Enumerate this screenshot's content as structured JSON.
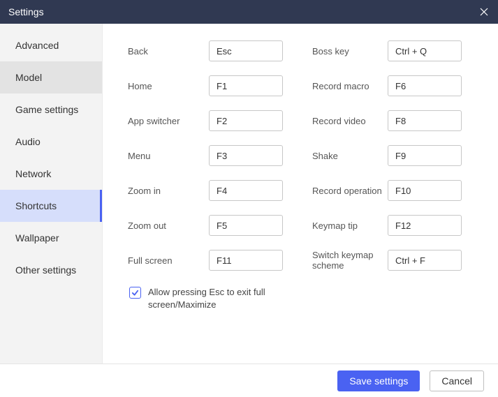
{
  "title": "Settings",
  "sidebar": {
    "items": [
      {
        "label": "Advanced",
        "active": false,
        "highlight": false
      },
      {
        "label": "Model",
        "active": false,
        "highlight": true
      },
      {
        "label": "Game settings",
        "active": false,
        "highlight": false
      },
      {
        "label": "Audio",
        "active": false,
        "highlight": false
      },
      {
        "label": "Network",
        "active": false,
        "highlight": false
      },
      {
        "label": "Shortcuts",
        "active": true,
        "highlight": false
      },
      {
        "label": "Wallpaper",
        "active": false,
        "highlight": false
      },
      {
        "label": "Other settings",
        "active": false,
        "highlight": false
      }
    ]
  },
  "shortcuts": {
    "left": [
      {
        "label": "Back",
        "value": "Esc"
      },
      {
        "label": "Home",
        "value": "F1"
      },
      {
        "label": "App switcher",
        "value": "F2"
      },
      {
        "label": "Menu",
        "value": "F3"
      },
      {
        "label": "Zoom in",
        "value": "F4"
      },
      {
        "label": "Zoom out",
        "value": "F5"
      },
      {
        "label": "Full screen",
        "value": "F11"
      }
    ],
    "right": [
      {
        "label": "Boss key",
        "value": "Ctrl + Q"
      },
      {
        "label": "Record macro",
        "value": "F6"
      },
      {
        "label": "Record video",
        "value": "F8"
      },
      {
        "label": "Shake",
        "value": "F9"
      },
      {
        "label": "Record operation",
        "value": "F10"
      },
      {
        "label": "Keymap tip",
        "value": "F12"
      },
      {
        "label": "Switch keymap scheme",
        "value": "Ctrl + F"
      }
    ],
    "allow_esc_label": "Allow pressing Esc to exit full screen/Maximize",
    "allow_esc_checked": true
  },
  "footer": {
    "save_label": "Save settings",
    "cancel_label": "Cancel"
  }
}
